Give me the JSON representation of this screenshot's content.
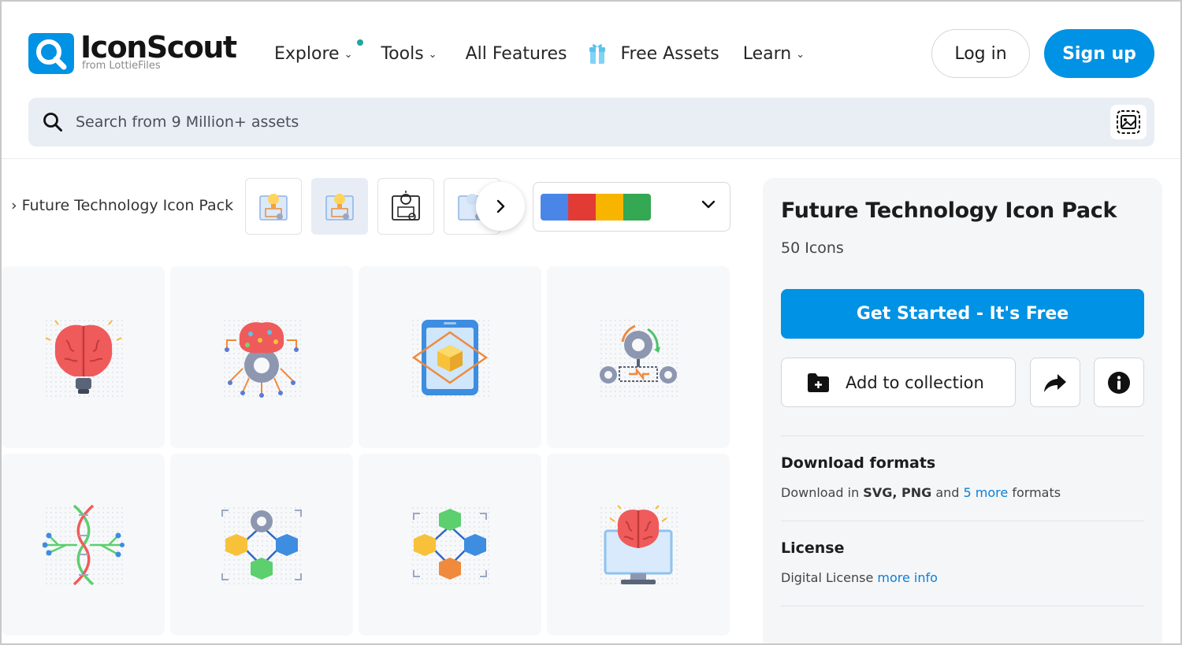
{
  "brand": {
    "name": "IconScout",
    "sub": "from LottieFiles",
    "accent": "#0092e4"
  },
  "nav": {
    "explore": "Explore",
    "tools": "Tools",
    "features": "All Features",
    "free_assets": "Free Assets",
    "learn": "Learn"
  },
  "auth": {
    "login": "Log in",
    "signup": "Sign up"
  },
  "search": {
    "placeholder": "Search from 9 Million+ assets"
  },
  "breadcrumb": {
    "current": "Future Technology Icon Pack"
  },
  "thumbnails": [
    "thumb-1",
    "thumb-2",
    "thumb-3",
    "thumb-4"
  ],
  "color_filter": {
    "swatches": [
      "#4a86e8",
      "#e23b35",
      "#f7b500",
      "#34a853"
    ]
  },
  "icons": [
    {
      "name": "brain-bulb-icon"
    },
    {
      "name": "brain-gear-network-icon"
    },
    {
      "name": "tablet-ar-cube-icon"
    },
    {
      "name": "gear-workflow-icon"
    },
    {
      "name": "dna-network-icon"
    },
    {
      "name": "cube-gear-network-icon"
    },
    {
      "name": "cube-blockchain-icon"
    },
    {
      "name": "brain-monitor-icon"
    }
  ],
  "panel": {
    "title": "Future Technology Icon Pack",
    "count": "50 Icons",
    "cta": "Get Started - It's Free",
    "collection": "Add to collection",
    "download": {
      "title": "Download formats",
      "prefix": "Download in",
      "formats": "SVG, PNG",
      "and": "and",
      "more": "5 more",
      "suffix": "formats"
    },
    "license": {
      "title": "License",
      "text": "Digital License",
      "link": "more info"
    }
  }
}
